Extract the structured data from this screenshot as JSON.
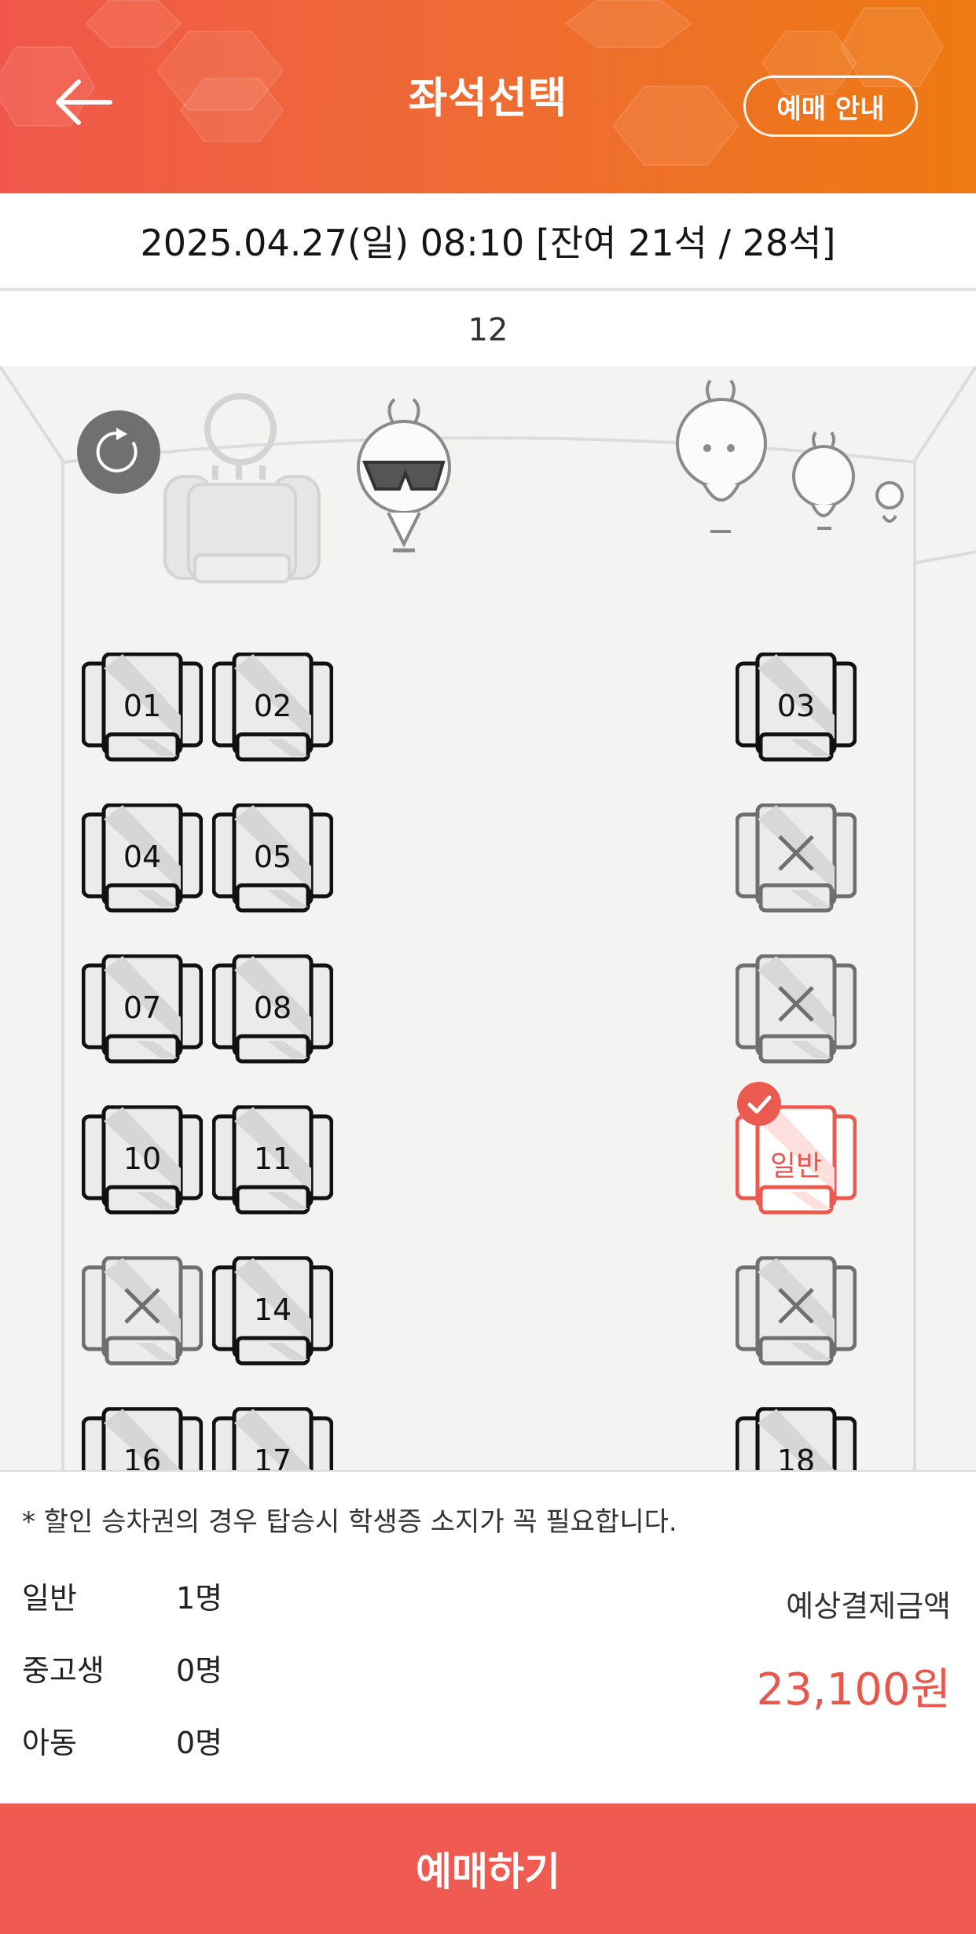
{
  "header": {
    "title": "좌석선택",
    "guide_label": "예매 안내",
    "back_icon": "arrow-left-icon"
  },
  "schedule": {
    "datetime_info": "2025.04.27(일) 08:10 [잔여 21석 / 28석]",
    "bus_number": "12"
  },
  "seats": [
    {
      "label": "01",
      "state": "available"
    },
    {
      "label": "02",
      "state": "available"
    },
    {
      "label": "03",
      "state": "available"
    },
    {
      "label": "04",
      "state": "available"
    },
    {
      "label": "05",
      "state": "available"
    },
    {
      "label": "",
      "state": "taken"
    },
    {
      "label": "07",
      "state": "available"
    },
    {
      "label": "08",
      "state": "available"
    },
    {
      "label": "",
      "state": "taken"
    },
    {
      "label": "10",
      "state": "available"
    },
    {
      "label": "11",
      "state": "available"
    },
    {
      "label": "일반",
      "state": "selected"
    },
    {
      "label": "",
      "state": "taken"
    },
    {
      "label": "14",
      "state": "available"
    },
    {
      "label": "",
      "state": "taken"
    },
    {
      "label": "16",
      "state": "available"
    },
    {
      "label": "17",
      "state": "available"
    },
    {
      "label": "18",
      "state": "available"
    }
  ],
  "summary": {
    "notice": "* 할인 승차권의 경우 탑승시 학생증 소지가 꼭 필요합니다.",
    "counts": [
      {
        "label": "일반",
        "value": "1명"
      },
      {
        "label": "중고생",
        "value": "0명"
      },
      {
        "label": "아동",
        "value": "0명"
      }
    ],
    "price_label": "예상결제금액",
    "price": "23,100원"
  },
  "book_button": "예매하기",
  "colors": {
    "accent": "#ef5b50",
    "header_start": "#f0574a",
    "header_end": "#ee7a12",
    "price": "#e9574c"
  }
}
